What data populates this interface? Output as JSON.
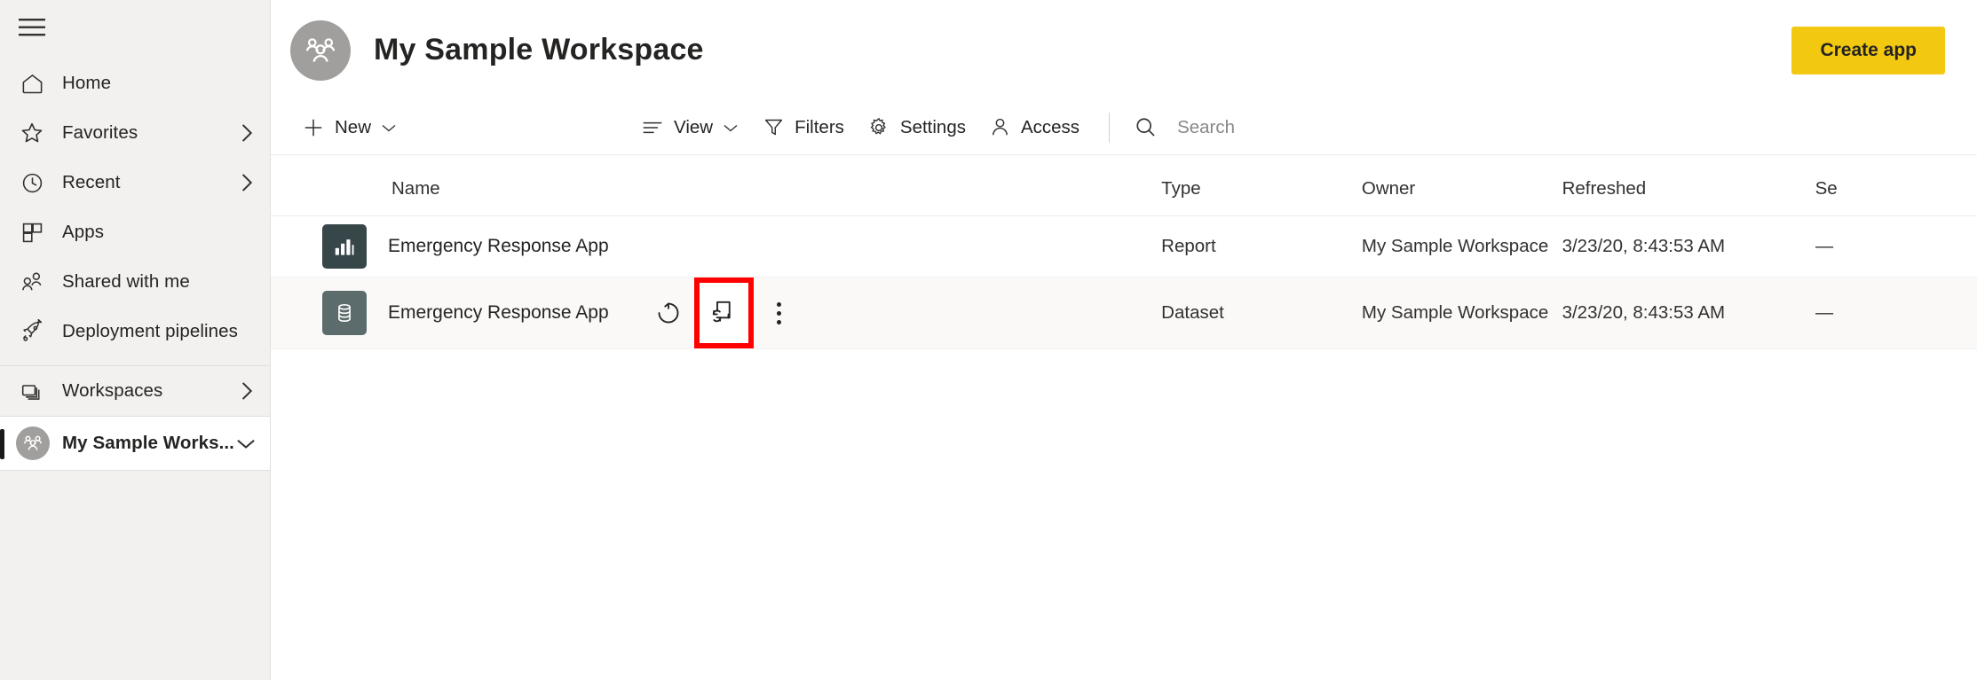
{
  "sidebar": {
    "menu_button": "hamburger-menu",
    "items": [
      {
        "label": "Home",
        "icon": "home-icon",
        "chevron": ""
      },
      {
        "label": "Favorites",
        "icon": "star-icon",
        "chevron": "›"
      },
      {
        "label": "Recent",
        "icon": "clock-icon",
        "chevron": "›"
      },
      {
        "label": "Apps",
        "icon": "apps-grid-icon",
        "chevron": ""
      },
      {
        "label": "Shared with me",
        "icon": "people-icon",
        "chevron": ""
      },
      {
        "label": "Deployment pipelines",
        "icon": "rocket-icon",
        "chevron": ""
      }
    ],
    "workspaces": {
      "label": "Workspaces",
      "icon": "workspaces-stack-icon",
      "chevron": "›"
    },
    "current_workspace": {
      "label": "My Sample Works...",
      "icon": "workspace-group-icon",
      "chevron": "⌄"
    }
  },
  "header": {
    "title": "My Sample Workspace",
    "avatar_icon": "workspace-group-icon",
    "create_app_label": "Create app",
    "accent_color": "#F2C811"
  },
  "toolbar": {
    "new_label": "New",
    "view_label": "View",
    "filters_label": "Filters",
    "settings_label": "Settings",
    "access_label": "Access",
    "search_placeholder": "Search",
    "search_value": ""
  },
  "table": {
    "columns": [
      "Name",
      "Type",
      "Owner",
      "Refreshed",
      "Se"
    ],
    "rows": [
      {
        "name": "Emergency Response App",
        "icon": "report-bar-chart-icon",
        "type": "Report",
        "owner": "My Sample Workspace",
        "refreshed": "3/23/20, 8:43:53 AM",
        "sensitivity": "—",
        "hovered": false,
        "actions": []
      },
      {
        "name": "Emergency Response App",
        "icon": "dataset-database-icon",
        "type": "Dataset",
        "owner": "My Sample Workspace",
        "refreshed": "3/23/20, 8:43:53 AM",
        "sensitivity": "—",
        "hovered": true,
        "actions": [
          "refresh-now-icon",
          "schedule-refresh-icon",
          "more-options-icon"
        ]
      }
    ]
  },
  "highlight": {
    "target": "schedule-refresh-button",
    "color": "#FF0000"
  }
}
